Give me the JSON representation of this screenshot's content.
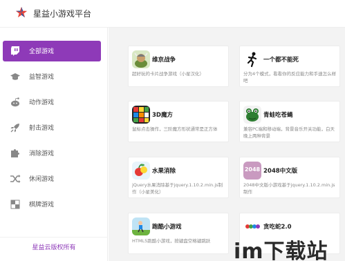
{
  "app": {
    "title": "星益小游戏平台",
    "accent_color": "#8e3ab8",
    "logo_icon": "star-logo-icon"
  },
  "sidebar": {
    "items": [
      {
        "label": "全部游戏",
        "icon": "twitch-icon",
        "active": true
      },
      {
        "label": "益智游戏",
        "icon": "graduation-cap-icon",
        "active": false
      },
      {
        "label": "动作游戏",
        "icon": "reddit-icon",
        "active": false
      },
      {
        "label": "射击游戏",
        "icon": "rocket-icon",
        "active": false
      },
      {
        "label": "消除游戏",
        "icon": "puzzle-icon",
        "active": false
      },
      {
        "label": "休闲游戏",
        "icon": "shuffle-icon",
        "active": false
      },
      {
        "label": "棋牌游戏",
        "icon": "checkerboard-icon",
        "active": false
      }
    ],
    "footer": "星益云版权所有"
  },
  "games": [
    {
      "name": "维京战争",
      "desc": "超好玩的卡片战争游戏（小星汉化）",
      "icon": "viking-icon"
    },
    {
      "name": "一个都不能死",
      "desc": "分为4个模式，看看你的反应能力和手速怎么样吧",
      "icon": "runner-icon"
    },
    {
      "name": "3D魔方",
      "desc": "鼠标点击操作，三阶魔方形状通常是正方体",
      "icon": "rubiks-cube-icon"
    },
    {
      "name": "青蛙吃苍蝇",
      "desc": "兼容PC端和移动端，背景音乐开关功能，白天晚上两种背景",
      "icon": "frog-icon"
    },
    {
      "name": "水果消除",
      "desc": "jQuery水果消除基于jquery.1.10.2.min.js制作（小星美化）",
      "icon": "fruit-icon"
    },
    {
      "name": "2048中文版",
      "desc": "2048中文版小游戏基于jquery.1.10.2.min.js制作",
      "icon": "2048-tile-icon",
      "icon_text": "2048"
    },
    {
      "name": "跑酷小游戏",
      "desc": "HTML5跑酷小游戏，按键盘空格键跳跃",
      "icon": "parkour-icon"
    },
    {
      "name": "贪吃蛇2.0",
      "desc": "",
      "icon": "snake-icon"
    }
  ],
  "watermark": "im下载站"
}
